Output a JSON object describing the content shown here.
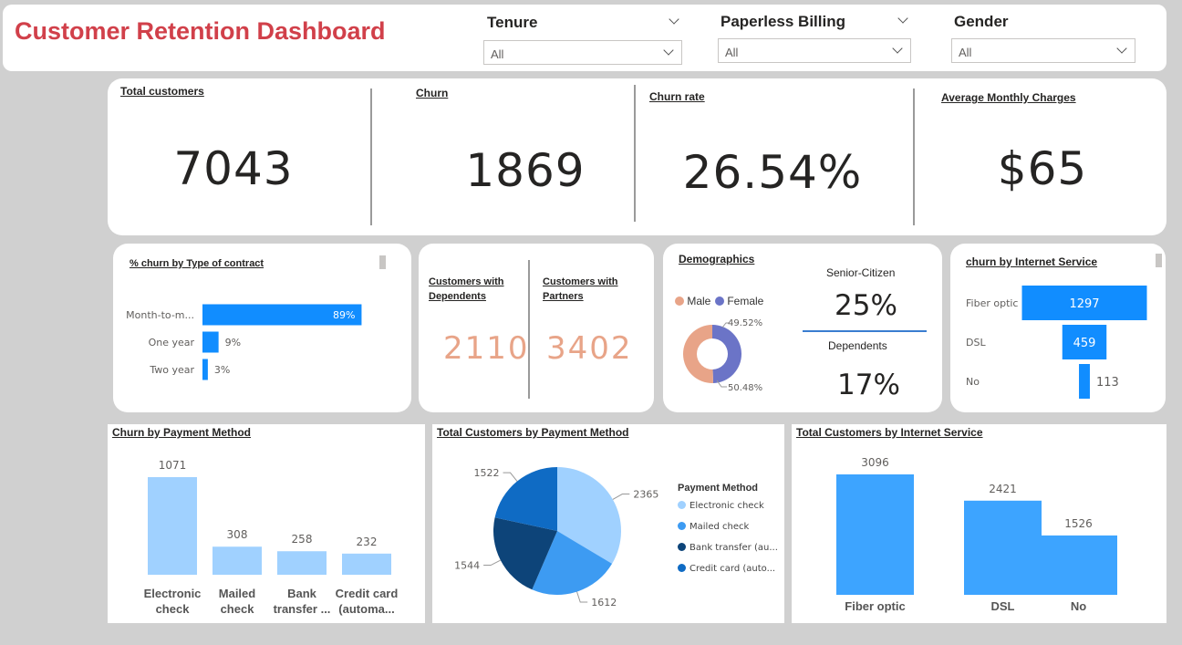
{
  "header": {
    "title": "Customer Retention Dashboard",
    "filters": [
      {
        "label": "Tenure",
        "value": "All"
      },
      {
        "label": "Paperless Billing",
        "value": "All"
      },
      {
        "label": "Gender",
        "value": "All"
      }
    ]
  },
  "kpis": [
    {
      "title": "Total customers",
      "value": "7043"
    },
    {
      "title": "Churn",
      "value": "1869"
    },
    {
      "title": "Churn rate",
      "value": "26.54%"
    },
    {
      "title": "Average Monthly Charges",
      "value": "$65"
    }
  ],
  "contract": {
    "title": "% churn by Type of contract",
    "chart_data": {
      "type": "bar",
      "orientation": "horizontal",
      "categories": [
        "Month-to-m...",
        "One year",
        "Two year"
      ],
      "values": [
        89,
        9,
        3
      ],
      "labels": [
        "89%",
        "9%",
        "3%"
      ],
      "color": "#118dff"
    }
  },
  "dependents": {
    "dep_title": "Customers with Dependents",
    "dep_value": "2110",
    "partner_title": "Customers with Partners",
    "partner_value": "3402"
  },
  "demographics": {
    "title": "Demographics",
    "legend": [
      {
        "name": "Male",
        "color": "#e8a488"
      },
      {
        "name": "Female",
        "color": "#6b74c7"
      }
    ],
    "chart_data": {
      "type": "pie",
      "donut": true,
      "slices": [
        {
          "name": "Male",
          "value": 50.48,
          "label": "50.48%"
        },
        {
          "name": "Female",
          "value": 49.52,
          "label": "49.52%"
        }
      ]
    },
    "senior_label": "Senior-Citizen",
    "senior_value": "25%",
    "dependents_label": "Dependents",
    "dependents_value": "17%"
  },
  "internet_churn": {
    "title": "churn by Internet Service",
    "chart_data": {
      "type": "bar",
      "orientation": "horizontal",
      "alignment": "centered",
      "categories": [
        "Fiber optic",
        "DSL",
        "No"
      ],
      "values": [
        1297,
        459,
        113
      ],
      "color": "#118dff"
    }
  },
  "payment_churn": {
    "title": "Churn by Payment Method",
    "chart_data": {
      "type": "bar",
      "categories": [
        "Electronic check",
        "Mailed check",
        "Bank transfer ...",
        "Credit card (automa..."
      ],
      "category_lines": [
        [
          "Electronic",
          "check"
        ],
        [
          "Mailed",
          "check"
        ],
        [
          "Bank",
          "transfer ..."
        ],
        [
          "Credit card",
          "(automa..."
        ]
      ],
      "values": [
        1071,
        308,
        258,
        232
      ],
      "color": "#a0d1ff"
    }
  },
  "payment_total": {
    "title": "Total Customers by Payment Method",
    "legend_title": "Payment Method",
    "chart_data": {
      "type": "pie",
      "slices": [
        {
          "name": "Electronic check",
          "value": 2365,
          "color": "#a0d1ff"
        },
        {
          "name": "Mailed check",
          "value": 1612,
          "color": "#3d9bf2"
        },
        {
          "name": "Bank transfer (au...",
          "value": 1544,
          "color": "#0d4479"
        },
        {
          "name": "Credit card (auto...",
          "value": 1522,
          "color": "#0f6bc4"
        }
      ]
    }
  },
  "internet_total": {
    "title": "Total Customers by Internet Service",
    "chart_data": {
      "type": "bar",
      "categories": [
        "Fiber optic",
        "DSL",
        "No"
      ],
      "values": [
        3096,
        2421,
        1526
      ],
      "color": "#3da4ff"
    }
  }
}
